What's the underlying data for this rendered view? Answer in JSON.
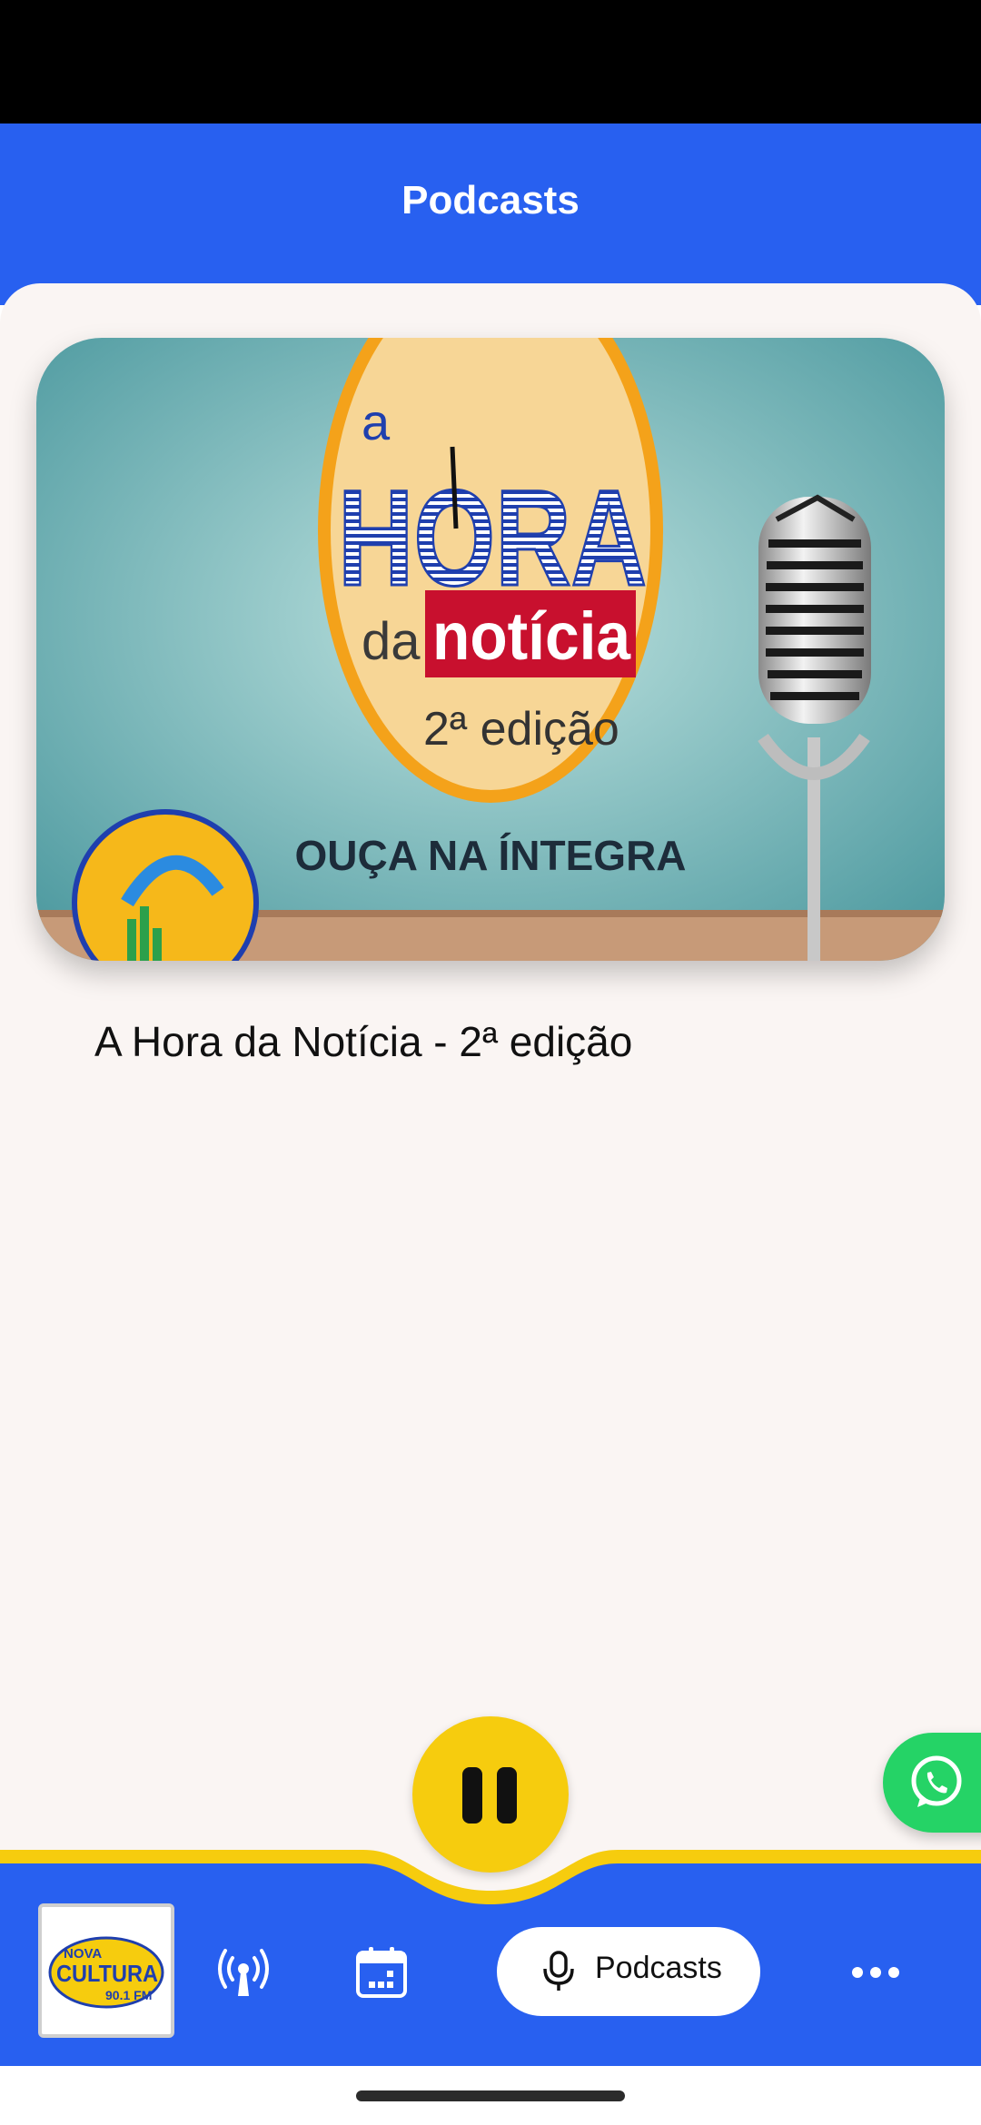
{
  "header": {
    "title": "Podcasts"
  },
  "podcast": {
    "title": "A Hora da Notícia - 2ª edição",
    "cover": {
      "line_a": "a",
      "line_hora": "HORA",
      "line_da": "da",
      "line_noticia": "notícia",
      "line_edicao": "2ª edição",
      "caption": "OUÇA NA ÍNTEGRA"
    }
  },
  "player": {
    "state": "playing",
    "button_icon": "pause-icon"
  },
  "bottom_nav": {
    "station_logo": {
      "line1": "NOVA",
      "line2": "CULTURA",
      "line3": "90.1 FM"
    },
    "items": [
      {
        "icon": "broadcast-icon",
        "label": ""
      },
      {
        "icon": "calendar-icon",
        "label": ""
      },
      {
        "icon": "microphone-icon",
        "label": "Podcasts",
        "active": true
      },
      {
        "icon": "more-icon",
        "label": ""
      }
    ]
  },
  "fab": {
    "icon": "whatsapp-icon"
  },
  "colors": {
    "primary": "#2860f0",
    "accent_yellow": "#f6cc0e",
    "background": "#faf5f3",
    "whatsapp": "#25d366"
  }
}
